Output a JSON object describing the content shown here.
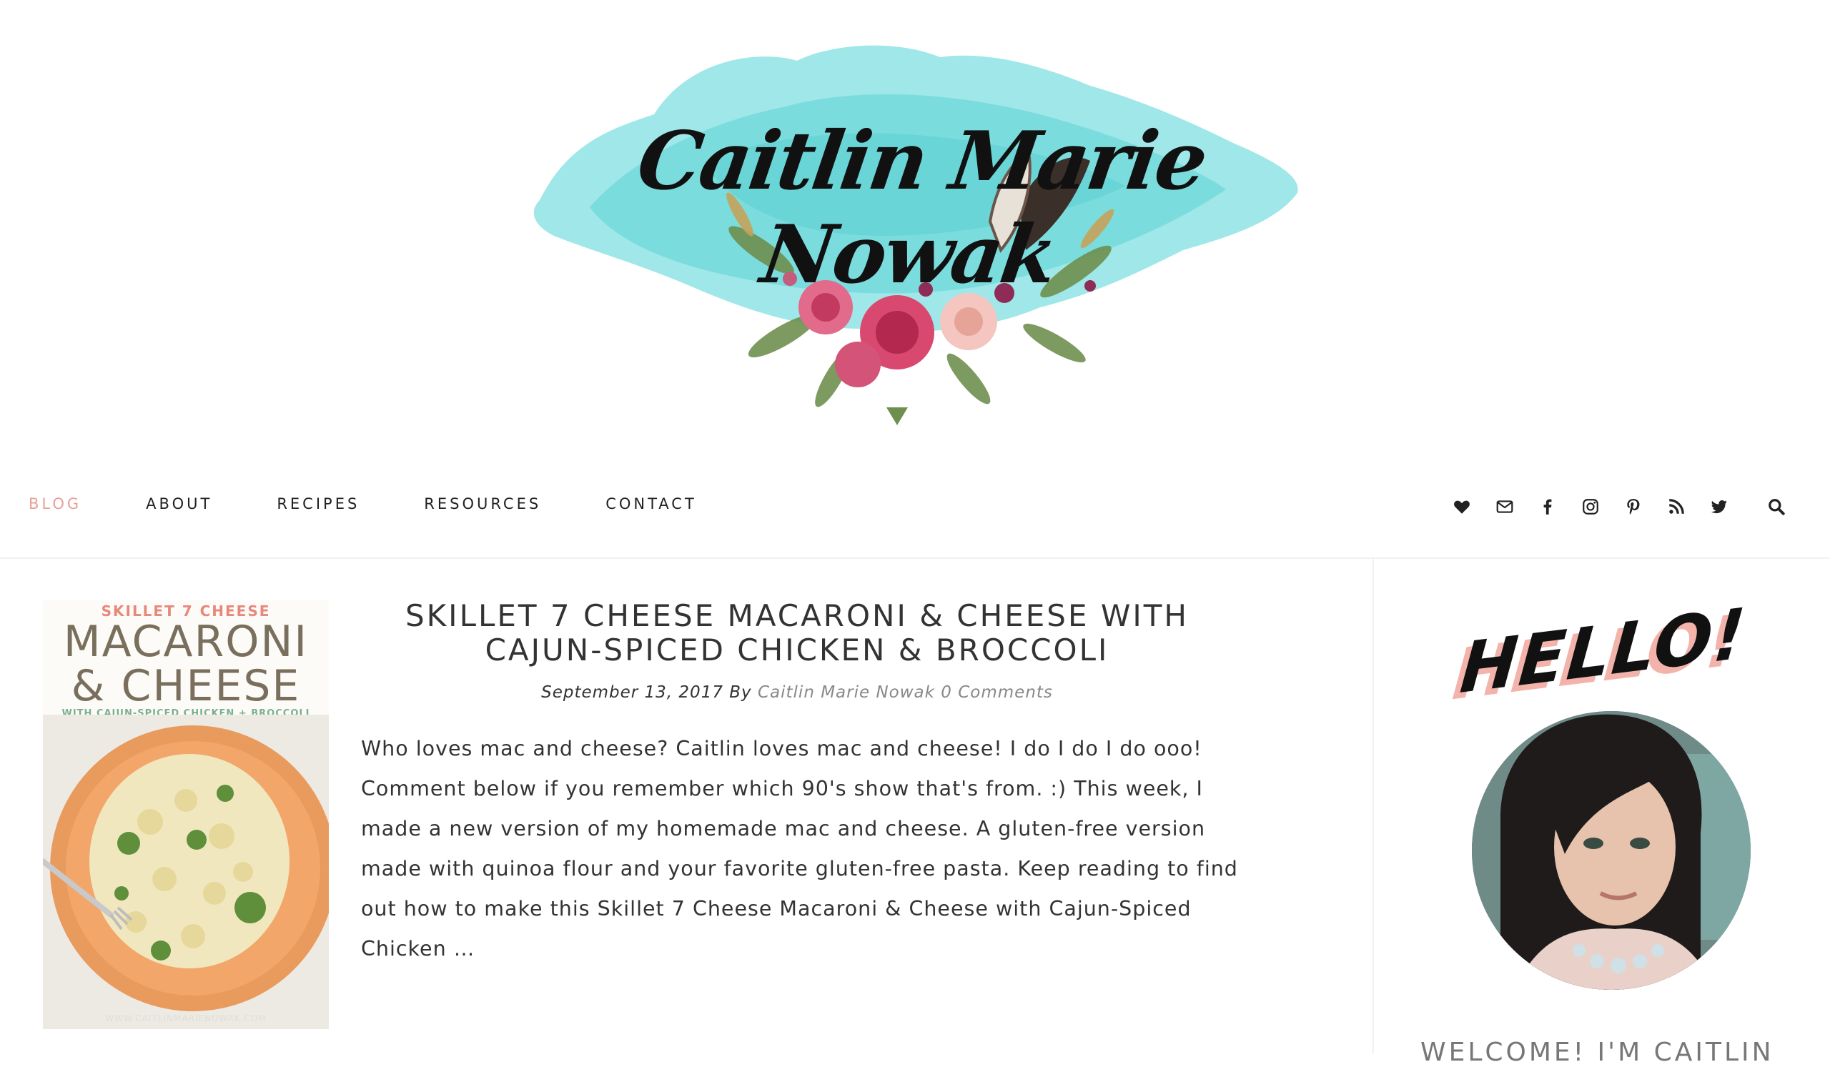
{
  "site": {
    "title": "Caitlin Marie Nowak"
  },
  "nav": {
    "items": [
      {
        "label": "BLOG",
        "active": true
      },
      {
        "label": "ABOUT",
        "active": false
      },
      {
        "label": "RECIPES",
        "active": false
      },
      {
        "label": "RESOURCES",
        "active": false
      },
      {
        "label": "CONTACT",
        "active": false
      }
    ],
    "active_color": "#e8a098",
    "social_icons": [
      "heart-icon",
      "mail-icon",
      "facebook-icon",
      "instagram-icon",
      "pinterest-icon",
      "rss-icon",
      "twitter-icon"
    ],
    "search_icon": "search-icon"
  },
  "post": {
    "thumbnail": {
      "line1": "SKILLET 7 CHEESE",
      "line2a": "MACARONI",
      "line2b": "& CHEESE",
      "line3": "WITH CAJUN-SPICED CHICKEN + BROCCOLI",
      "footer": "WWW.CAITLINMARIENOWAK.COM"
    },
    "title": "SKILLET 7 CHEESE MACARONI & CHEESE WITH CAJUN-SPICED CHICKEN & BROCCOLI",
    "date": "September 13, 2017",
    "by": "By",
    "author": "Caitlin Marie Nowak",
    "comments": "0 Comments",
    "excerpt": "Who loves mac and cheese? Caitlin loves mac and cheese! I do I do I do ooo! Comment below if you remember which 90's show that's from. :) This week, I made a new version of my homemade mac and cheese. A gluten-free version made with quinoa flour and your favorite gluten-free pasta. Keep reading to find out how to make this Skillet 7 Cheese Macaroni & Cheese with Cajun-Spiced Chicken …"
  },
  "sidebar": {
    "hello": "HELLO!",
    "welcome": "WELCOME! I'M CAITLIN"
  }
}
